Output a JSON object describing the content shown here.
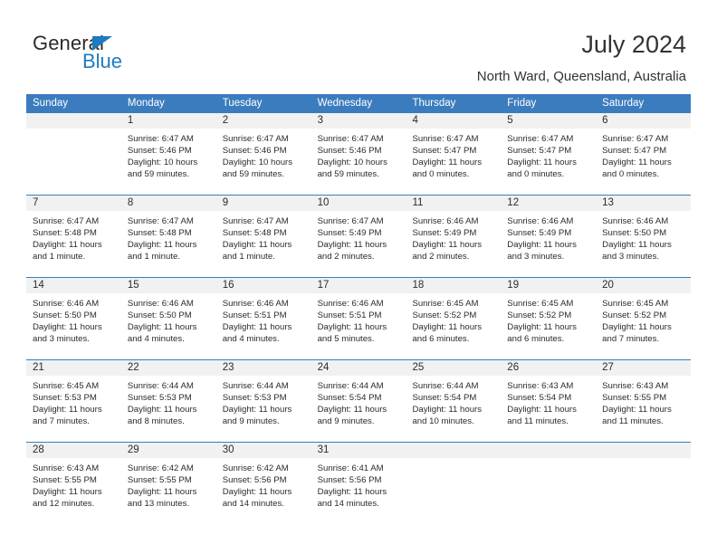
{
  "brand": {
    "name_top": "General",
    "name_bottom": "Blue",
    "accent_color": "#1f7ac0"
  },
  "header": {
    "title": "July 2024",
    "subtitle": "North Ward, Queensland, Australia"
  },
  "calendar": {
    "header_bg": "#3b7cbe",
    "daynum_bg": "#f1f1f1",
    "day_names": [
      "Sunday",
      "Monday",
      "Tuesday",
      "Wednesday",
      "Thursday",
      "Friday",
      "Saturday"
    ],
    "weeks": [
      [
        {
          "day": "",
          "lines": []
        },
        {
          "day": "1",
          "lines": [
            "Sunrise: 6:47 AM",
            "Sunset: 5:46 PM",
            "Daylight: 10 hours",
            "and 59 minutes."
          ]
        },
        {
          "day": "2",
          "lines": [
            "Sunrise: 6:47 AM",
            "Sunset: 5:46 PM",
            "Daylight: 10 hours",
            "and 59 minutes."
          ]
        },
        {
          "day": "3",
          "lines": [
            "Sunrise: 6:47 AM",
            "Sunset: 5:46 PM",
            "Daylight: 10 hours",
            "and 59 minutes."
          ]
        },
        {
          "day": "4",
          "lines": [
            "Sunrise: 6:47 AM",
            "Sunset: 5:47 PM",
            "Daylight: 11 hours",
            "and 0 minutes."
          ]
        },
        {
          "day": "5",
          "lines": [
            "Sunrise: 6:47 AM",
            "Sunset: 5:47 PM",
            "Daylight: 11 hours",
            "and 0 minutes."
          ]
        },
        {
          "day": "6",
          "lines": [
            "Sunrise: 6:47 AM",
            "Sunset: 5:47 PM",
            "Daylight: 11 hours",
            "and 0 minutes."
          ]
        }
      ],
      [
        {
          "day": "7",
          "lines": [
            "Sunrise: 6:47 AM",
            "Sunset: 5:48 PM",
            "Daylight: 11 hours",
            "and 1 minute."
          ]
        },
        {
          "day": "8",
          "lines": [
            "Sunrise: 6:47 AM",
            "Sunset: 5:48 PM",
            "Daylight: 11 hours",
            "and 1 minute."
          ]
        },
        {
          "day": "9",
          "lines": [
            "Sunrise: 6:47 AM",
            "Sunset: 5:48 PM",
            "Daylight: 11 hours",
            "and 1 minute."
          ]
        },
        {
          "day": "10",
          "lines": [
            "Sunrise: 6:47 AM",
            "Sunset: 5:49 PM",
            "Daylight: 11 hours",
            "and 2 minutes."
          ]
        },
        {
          "day": "11",
          "lines": [
            "Sunrise: 6:46 AM",
            "Sunset: 5:49 PM",
            "Daylight: 11 hours",
            "and 2 minutes."
          ]
        },
        {
          "day": "12",
          "lines": [
            "Sunrise: 6:46 AM",
            "Sunset: 5:49 PM",
            "Daylight: 11 hours",
            "and 3 minutes."
          ]
        },
        {
          "day": "13",
          "lines": [
            "Sunrise: 6:46 AM",
            "Sunset: 5:50 PM",
            "Daylight: 11 hours",
            "and 3 minutes."
          ]
        }
      ],
      [
        {
          "day": "14",
          "lines": [
            "Sunrise: 6:46 AM",
            "Sunset: 5:50 PM",
            "Daylight: 11 hours",
            "and 3 minutes."
          ]
        },
        {
          "day": "15",
          "lines": [
            "Sunrise: 6:46 AM",
            "Sunset: 5:50 PM",
            "Daylight: 11 hours",
            "and 4 minutes."
          ]
        },
        {
          "day": "16",
          "lines": [
            "Sunrise: 6:46 AM",
            "Sunset: 5:51 PM",
            "Daylight: 11 hours",
            "and 4 minutes."
          ]
        },
        {
          "day": "17",
          "lines": [
            "Sunrise: 6:46 AM",
            "Sunset: 5:51 PM",
            "Daylight: 11 hours",
            "and 5 minutes."
          ]
        },
        {
          "day": "18",
          "lines": [
            "Sunrise: 6:45 AM",
            "Sunset: 5:52 PM",
            "Daylight: 11 hours",
            "and 6 minutes."
          ]
        },
        {
          "day": "19",
          "lines": [
            "Sunrise: 6:45 AM",
            "Sunset: 5:52 PM",
            "Daylight: 11 hours",
            "and 6 minutes."
          ]
        },
        {
          "day": "20",
          "lines": [
            "Sunrise: 6:45 AM",
            "Sunset: 5:52 PM",
            "Daylight: 11 hours",
            "and 7 minutes."
          ]
        }
      ],
      [
        {
          "day": "21",
          "lines": [
            "Sunrise: 6:45 AM",
            "Sunset: 5:53 PM",
            "Daylight: 11 hours",
            "and 7 minutes."
          ]
        },
        {
          "day": "22",
          "lines": [
            "Sunrise: 6:44 AM",
            "Sunset: 5:53 PM",
            "Daylight: 11 hours",
            "and 8 minutes."
          ]
        },
        {
          "day": "23",
          "lines": [
            "Sunrise: 6:44 AM",
            "Sunset: 5:53 PM",
            "Daylight: 11 hours",
            "and 9 minutes."
          ]
        },
        {
          "day": "24",
          "lines": [
            "Sunrise: 6:44 AM",
            "Sunset: 5:54 PM",
            "Daylight: 11 hours",
            "and 9 minutes."
          ]
        },
        {
          "day": "25",
          "lines": [
            "Sunrise: 6:44 AM",
            "Sunset: 5:54 PM",
            "Daylight: 11 hours",
            "and 10 minutes."
          ]
        },
        {
          "day": "26",
          "lines": [
            "Sunrise: 6:43 AM",
            "Sunset: 5:54 PM",
            "Daylight: 11 hours",
            "and 11 minutes."
          ]
        },
        {
          "day": "27",
          "lines": [
            "Sunrise: 6:43 AM",
            "Sunset: 5:55 PM",
            "Daylight: 11 hours",
            "and 11 minutes."
          ]
        }
      ],
      [
        {
          "day": "28",
          "lines": [
            "Sunrise: 6:43 AM",
            "Sunset: 5:55 PM",
            "Daylight: 11 hours",
            "and 12 minutes."
          ]
        },
        {
          "day": "29",
          "lines": [
            "Sunrise: 6:42 AM",
            "Sunset: 5:55 PM",
            "Daylight: 11 hours",
            "and 13 minutes."
          ]
        },
        {
          "day": "30",
          "lines": [
            "Sunrise: 6:42 AM",
            "Sunset: 5:56 PM",
            "Daylight: 11 hours",
            "and 14 minutes."
          ]
        },
        {
          "day": "31",
          "lines": [
            "Sunrise: 6:41 AM",
            "Sunset: 5:56 PM",
            "Daylight: 11 hours",
            "and 14 minutes."
          ]
        },
        {
          "day": "",
          "lines": []
        },
        {
          "day": "",
          "lines": []
        },
        {
          "day": "",
          "lines": []
        }
      ]
    ]
  }
}
